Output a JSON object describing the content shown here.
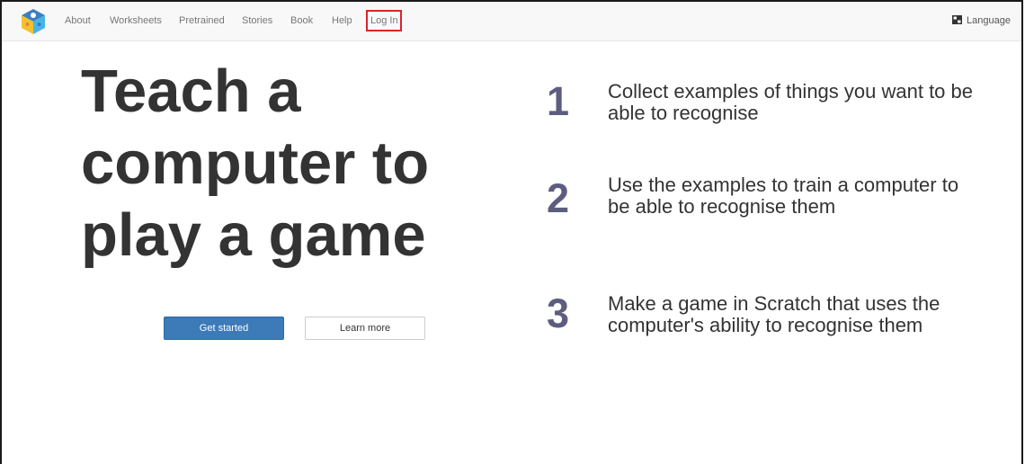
{
  "nav": {
    "logo_icon": "machine-learning-for-kids-logo",
    "items": [
      {
        "label": "About"
      },
      {
        "label": "Worksheets"
      },
      {
        "label": "Pretrained"
      },
      {
        "label": "Stories"
      },
      {
        "label": "Book"
      },
      {
        "label": "Help"
      },
      {
        "label": "Log In"
      }
    ],
    "language": {
      "label": "Language",
      "icon": "language-flag-icon"
    },
    "highlight_color": "#d9262b"
  },
  "hero": {
    "title_lines": [
      "Teach a",
      "computer to",
      "play a game"
    ]
  },
  "buttons": {
    "get_started": "Get started",
    "learn_more": "Learn more",
    "primary_color": "#3d7ab8"
  },
  "steps": [
    {
      "number": "1",
      "text": "Collect examples of things you want to be able to recognise"
    },
    {
      "number": "2",
      "text": "Use the examples to train a computer to be able to recognise them"
    },
    {
      "number": "3",
      "text": "Make a game in Scratch that uses the computer's ability to recognise them"
    }
  ],
  "colors": {
    "step_number": "#5d5d7f",
    "headline": "#333333",
    "navbar_bg": "#f8f8f8"
  }
}
